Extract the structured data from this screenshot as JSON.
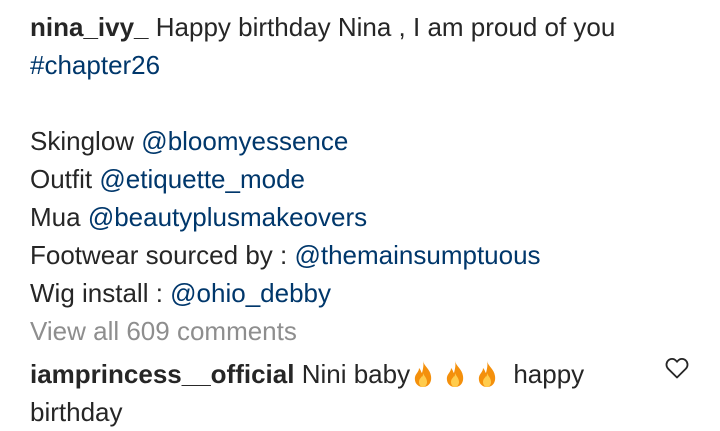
{
  "caption": {
    "username": "nina_ivy_",
    "text": "Happy birthday Nina , I am proud of you",
    "hashtag": "#chapter26",
    "credits": [
      {
        "label": "Skinglow",
        "handle": "@bloomyessence"
      },
      {
        "label": "Outfit",
        "handle": "@etiquette_mode"
      },
      {
        "label": "Mua",
        "handle": "@beautyplusmakeovers"
      },
      {
        "label": "Footwear sourced by :",
        "handle": "@themainsumptuous"
      },
      {
        "label": "Wig install :",
        "handle": "@ohio_debby"
      }
    ]
  },
  "view_all_comments": "View all 609 comments",
  "comment": {
    "username": "iamprincess__official",
    "text_before": "Nini baby",
    "emojis": [
      "fire-emoji",
      "fire-emoji",
      "fire-emoji"
    ],
    "text_after": "happy birthday"
  },
  "like_icon": "heart-outline-icon",
  "colors": {
    "text": "#262626",
    "link": "#00376b",
    "muted": "#8e8e8e",
    "fire_outer": "#f4900c",
    "fire_inner": "#ffcc4d"
  }
}
